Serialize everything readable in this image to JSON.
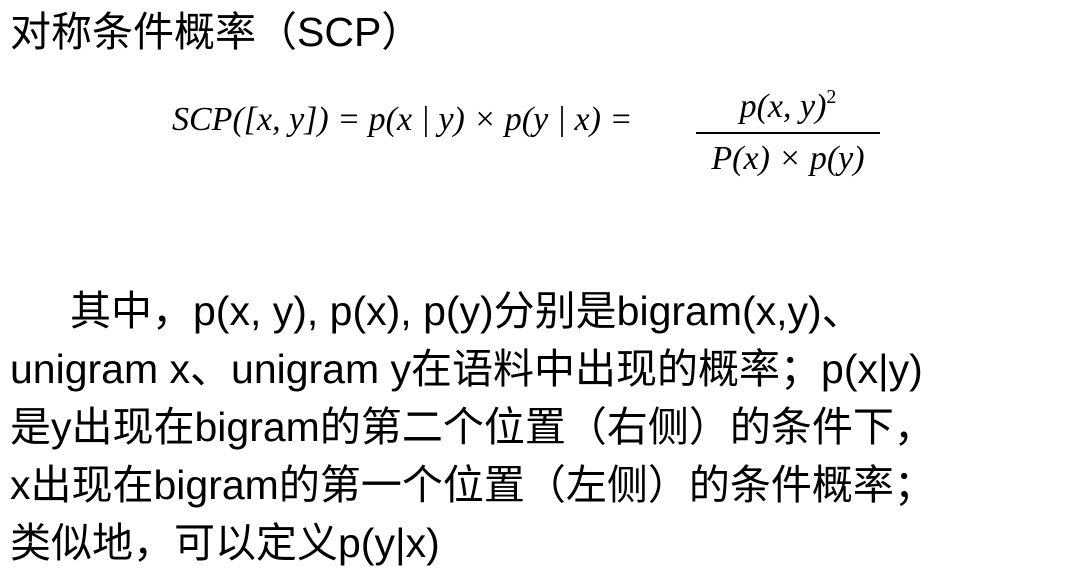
{
  "title": "对称条件概率（SCP）",
  "formula": {
    "lhs": "SCP([x, y]) = p(x | y) × p(y | x) =",
    "numerator": "p(x, y)",
    "numerator_exponent": "2",
    "denominator": "P(x) × p(y)"
  },
  "paragraph": {
    "lines": [
      "其中，p(x, y), p(x), p(y)分别是bigram(x,y)、",
      "unigram x、unigram y在语料中出现的概率；p(x|y)",
      "是y出现在bigram的第二个位置（右侧）的条件下，",
      "x出现在bigram的第一个位置（左侧）的条件概率；",
      "类似地，可以定义p(y|x)"
    ]
  }
}
